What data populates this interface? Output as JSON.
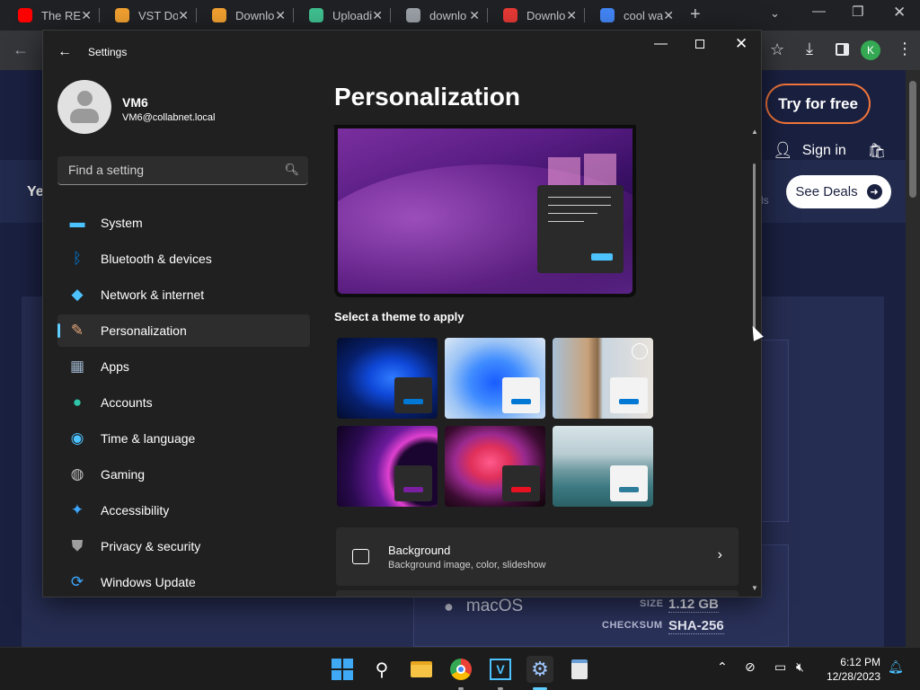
{
  "browser": {
    "tabs": [
      {
        "label": "The REAL",
        "icon_color": "#ff0000"
      },
      {
        "label": "VST Dow",
        "icon_color": "#f0a030"
      },
      {
        "label": "Downlo",
        "icon_color": "#f0a030"
      },
      {
        "label": "Uploadi",
        "icon_color": "#3fbf8f"
      },
      {
        "label": "downlo",
        "icon_color": "#9aa0a6"
      },
      {
        "label": "Downlo",
        "icon_color": "#e53935"
      },
      {
        "label": "cool wa",
        "icon_color": "#4285f4"
      }
    ],
    "profile_initial": "K"
  },
  "site": {
    "try_button": "Try for free",
    "sign_in": "Sign in",
    "see_deals": "See Deals",
    "partial_left": "Ye",
    "partial_right": "ls",
    "os_name": "macOS",
    "size_label": "SIZE",
    "size_value": "1.12 GB",
    "checksum_label": "CHECKSUM",
    "checksum_value": "SHA-256"
  },
  "settings": {
    "title": "Settings",
    "user": {
      "name": "VM6",
      "email": "VM6@collabnet.local"
    },
    "search_placeholder": "Find a setting",
    "nav": [
      {
        "label": "System",
        "icon": "system-icon",
        "color": "#4cc2ff"
      },
      {
        "label": "Bluetooth & devices",
        "icon": "bluetooth-icon",
        "color": "#0078d4"
      },
      {
        "label": "Network & internet",
        "icon": "wifi-icon",
        "color": "#4cc2ff"
      },
      {
        "label": "Personalization",
        "icon": "brush-icon",
        "color": "#e8a87c",
        "active": true
      },
      {
        "label": "Apps",
        "icon": "apps-icon",
        "color": "#9ab0c8"
      },
      {
        "label": "Accounts",
        "icon": "accounts-icon",
        "color": "#2fc4a8"
      },
      {
        "label": "Time & language",
        "icon": "globe-icon",
        "color": "#4cc2ff"
      },
      {
        "label": "Gaming",
        "icon": "gamepad-icon",
        "color": "#bdbdbd"
      },
      {
        "label": "Accessibility",
        "icon": "accessibility-icon",
        "color": "#3ba7ff"
      },
      {
        "label": "Privacy & security",
        "icon": "shield-icon",
        "color": "#9e9e9e"
      },
      {
        "label": "Windows Update",
        "icon": "update-icon",
        "color": "#3ba7ff"
      }
    ],
    "page_title": "Personalization",
    "themes_label": "Select a theme to apply",
    "background": {
      "title": "Background",
      "subtitle": "Background image, color, slideshow"
    }
  },
  "taskbar": {
    "time": "6:12 PM",
    "date": "12/28/2023"
  }
}
